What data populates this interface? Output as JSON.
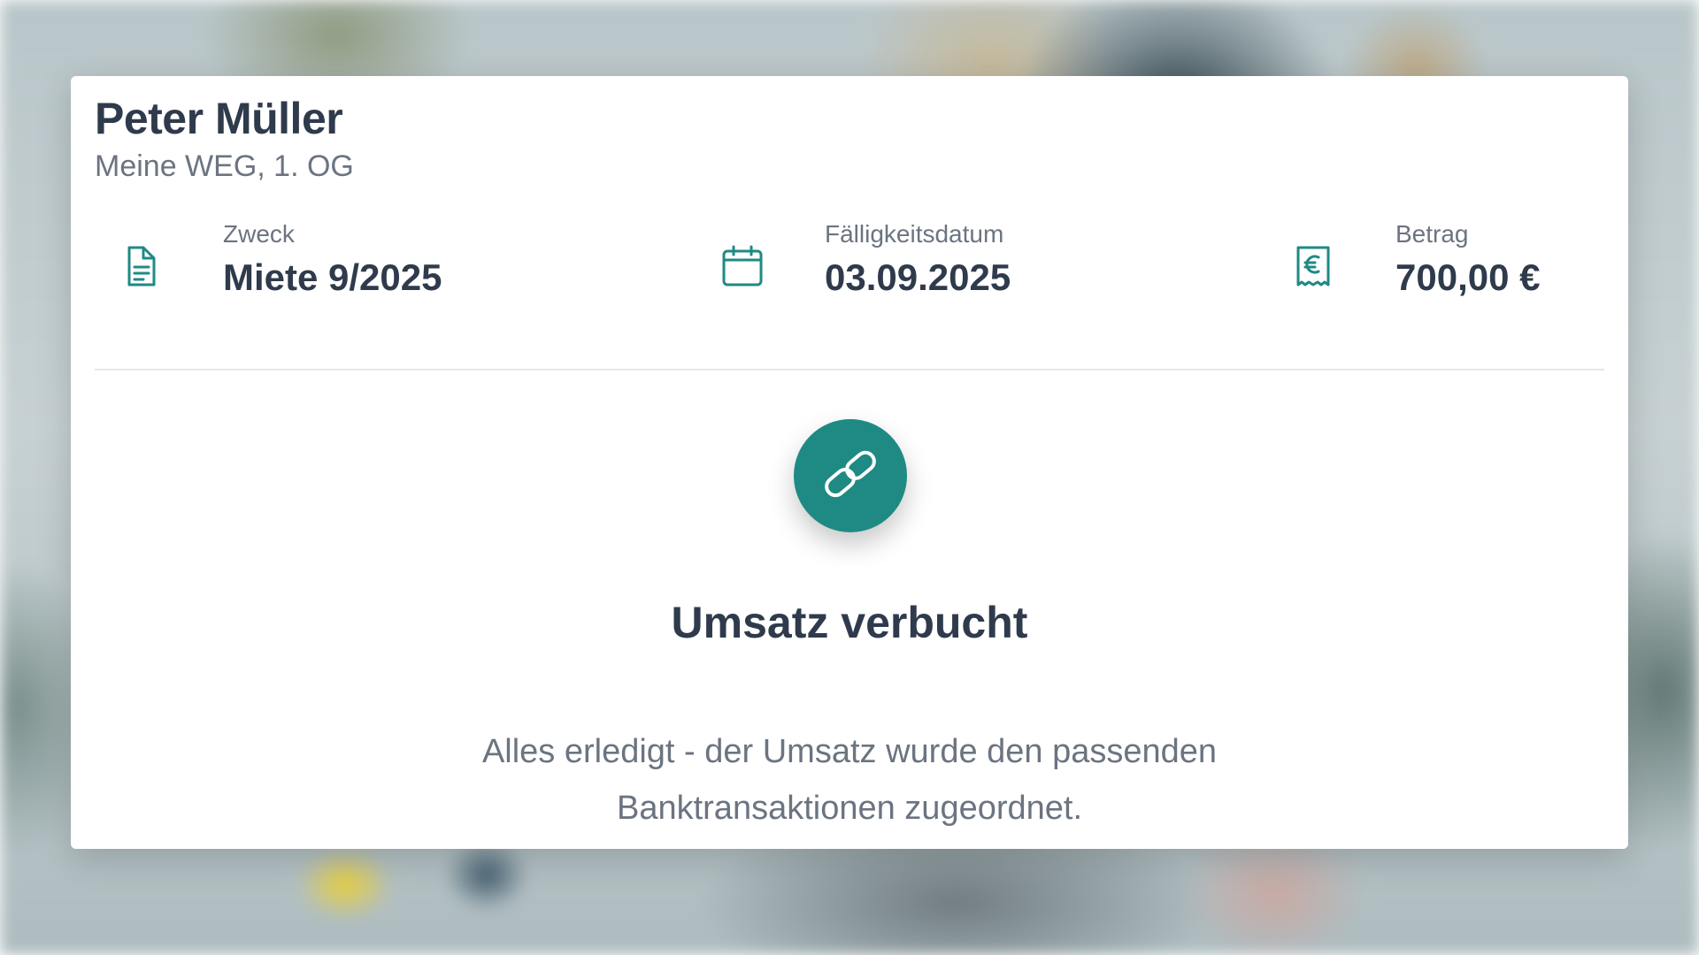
{
  "record": {
    "name": "Peter Müller",
    "unit": "Meine WEG, 1. OG"
  },
  "details": [
    {
      "icon": "document-icon",
      "label": "Zweck",
      "value": "Miete 9/2025"
    },
    {
      "icon": "calendar-icon",
      "label": "Fälligkeitsdatum",
      "value": "03.09.2025"
    },
    {
      "icon": "receipt-euro-icon",
      "label": "Betrag",
      "value": "700,00 €"
    }
  ],
  "status": {
    "icon": "link-icon",
    "title": "Umsatz verbucht",
    "message": "Alles erledigt - der Umsatz wurde den passenden Banktransaktionen zugeordnet."
  },
  "colors": {
    "accent": "#1f8a84",
    "text_primary": "#2f3b4c",
    "text_secondary": "#6b7480"
  }
}
